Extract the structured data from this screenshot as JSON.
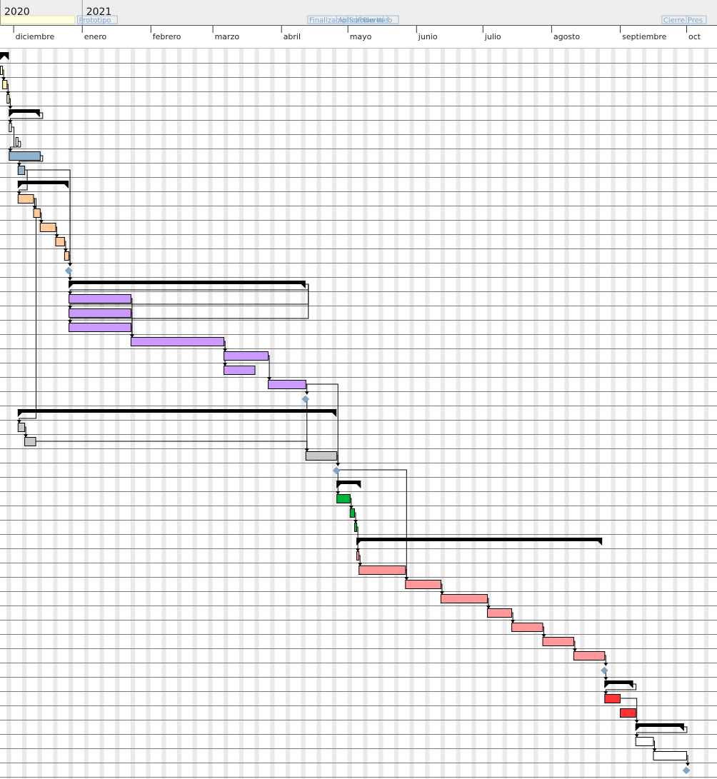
{
  "timeline": {
    "years": [
      {
        "label": "2020",
        "date": "2020-11-25"
      },
      {
        "label": "2021",
        "date": "2021-01-01"
      }
    ],
    "months": [
      {
        "label": "diciembre",
        "date": "2020-12-01"
      },
      {
        "label": "enero",
        "date": "2021-01-01"
      },
      {
        "label": "febrero",
        "date": "2021-02-01"
      },
      {
        "label": "marzo",
        "date": "2021-03-01"
      },
      {
        "label": "abril",
        "date": "2021-04-01"
      },
      {
        "label": "mayo",
        "date": "2021-05-01"
      },
      {
        "label": "junio",
        "date": "2021-06-01"
      },
      {
        "label": "julio",
        "date": "2021-07-01"
      },
      {
        "label": "agosto",
        "date": "2021-08-01"
      },
      {
        "label": "septiembre",
        "date": "2021-09-01"
      },
      {
        "label": "oct",
        "date": "2021-10-01"
      }
    ],
    "milestone_flags": [
      {
        "label": "Prototipo",
        "date": "2020-12-30"
      },
      {
        "label": "Finalizació",
        "date": "2021-04-13"
      },
      {
        "label": "Aplicación Web",
        "date": "2021-04-26"
      },
      {
        "label": "Software",
        "date": "2021-05-01"
      },
      {
        "label": "Cierre",
        "date": "2021-05-07"
      },
      {
        "label": "Cierre",
        "date": "2021-09-20"
      },
      {
        "label": "Pres",
        "date": "2021-10-01"
      }
    ],
    "highlight_flag": {
      "label": "",
      "date": "2020-11-25",
      "end": "2020-12-29"
    }
  },
  "colors": {
    "header_bg": "#eeeeee",
    "grid_line": "#7a7a7a",
    "weekend_band": "#eaeaea",
    "summary": "#000000",
    "milestone": "#7fa4c4",
    "link": "#000000",
    "flag_text": "#7ea7cf",
    "flag_border": "#9cc0df"
  },
  "tasks": [
    {
      "type": "summary",
      "start": "2020-11-25",
      "end": "2020-11-29"
    },
    {
      "type": "task",
      "start": "2020-11-25",
      "end": "2020-11-26",
      "color": "#ffffcc"
    },
    {
      "type": "task",
      "start": "2020-11-26",
      "end": "2020-11-28",
      "color": "#fff2b3"
    },
    {
      "type": "task",
      "start": "2020-11-28",
      "end": "2020-11-29",
      "color": "#ffffcc"
    },
    {
      "type": "summary",
      "start": "2020-11-29",
      "end": "2020-12-13"
    },
    {
      "type": "task",
      "start": "2020-11-29",
      "end": "2020-11-30",
      "color": "#ffffff"
    },
    {
      "type": "task",
      "start": "2020-12-02",
      "end": "2020-12-03",
      "color": "#ffffff"
    },
    {
      "type": "task",
      "start": "2020-11-29",
      "end": "2020-12-13",
      "color": "#8fb3cf"
    },
    {
      "type": "task",
      "start": "2020-12-03",
      "end": "2020-12-06",
      "color": "#8fb3cf"
    },
    {
      "type": "summary",
      "start": "2020-12-03",
      "end": "2020-12-26"
    },
    {
      "type": "task",
      "start": "2020-12-03",
      "end": "2020-12-10",
      "color": "#ffcc99"
    },
    {
      "type": "task",
      "start": "2020-12-10",
      "end": "2020-12-13",
      "color": "#ffcc99"
    },
    {
      "type": "task",
      "start": "2020-12-13",
      "end": "2020-12-20",
      "color": "#ffcc99"
    },
    {
      "type": "task",
      "start": "2020-12-20",
      "end": "2020-12-24",
      "color": "#ffcc99"
    },
    {
      "type": "task",
      "start": "2020-12-24",
      "end": "2020-12-26",
      "color": "#ffcc99"
    },
    {
      "type": "milestone",
      "start": "2020-12-26"
    },
    {
      "type": "summary",
      "start": "2020-12-26",
      "end": "2021-04-12"
    },
    {
      "type": "task",
      "start": "2020-12-26",
      "end": "2021-01-23",
      "color": "#cc99ff"
    },
    {
      "type": "task",
      "start": "2020-12-26",
      "end": "2021-01-23",
      "color": "#cc99ff"
    },
    {
      "type": "task",
      "start": "2020-12-26",
      "end": "2021-01-23",
      "color": "#cc99ff"
    },
    {
      "type": "task",
      "start": "2021-01-23",
      "end": "2021-03-06",
      "color": "#cc99ff"
    },
    {
      "type": "task",
      "start": "2021-03-06",
      "end": "2021-03-26",
      "color": "#cc99ff"
    },
    {
      "type": "task",
      "start": "2021-03-06",
      "end": "2021-03-20",
      "color": "#cc99ff"
    },
    {
      "type": "task",
      "start": "2021-03-26",
      "end": "2021-04-12",
      "color": "#cc99ff"
    },
    {
      "type": "milestone",
      "start": "2021-04-12"
    },
    {
      "type": "summary",
      "start": "2020-12-03",
      "end": "2021-04-26"
    },
    {
      "type": "task",
      "start": "2020-12-03",
      "end": "2020-12-06",
      "color": "#c8c8c8"
    },
    {
      "type": "task",
      "start": "2020-12-06",
      "end": "2020-12-11",
      "color": "#c8c8c8"
    },
    {
      "type": "task",
      "start": "2021-04-12",
      "end": "2021-04-26",
      "color": "#c8c8c8"
    },
    {
      "type": "milestone",
      "start": "2021-04-26"
    },
    {
      "type": "summary",
      "start": "2021-04-26",
      "end": "2021-05-07"
    },
    {
      "type": "task",
      "start": "2021-04-26",
      "end": "2021-05-02",
      "color": "#00b33c"
    },
    {
      "type": "task",
      "start": "2021-05-02",
      "end": "2021-05-04",
      "color": "#00b33c"
    },
    {
      "type": "task",
      "start": "2021-05-04",
      "end": "2021-05-05",
      "color": "#00b33c"
    },
    {
      "type": "summary",
      "start": "2021-05-05",
      "end": "2021-08-24"
    },
    {
      "type": "task",
      "start": "2021-05-05",
      "end": "2021-05-06",
      "color": "#ff9999"
    },
    {
      "type": "task",
      "start": "2021-05-06",
      "end": "2021-05-27",
      "color": "#ff9999"
    },
    {
      "type": "task",
      "start": "2021-05-27",
      "end": "2021-06-12",
      "color": "#ff9999"
    },
    {
      "type": "task",
      "start": "2021-06-12",
      "end": "2021-07-03",
      "color": "#ff9999"
    },
    {
      "type": "task",
      "start": "2021-07-03",
      "end": "2021-07-14",
      "color": "#ff9999"
    },
    {
      "type": "task",
      "start": "2021-07-14",
      "end": "2021-07-28",
      "color": "#ff9999"
    },
    {
      "type": "task",
      "start": "2021-07-28",
      "end": "2021-08-11",
      "color": "#ff9999"
    },
    {
      "type": "task",
      "start": "2021-08-11",
      "end": "2021-08-25",
      "color": "#ff9999"
    },
    {
      "type": "milestone",
      "start": "2021-08-25"
    },
    {
      "type": "summary",
      "start": "2021-08-25",
      "end": "2021-09-07"
    },
    {
      "type": "task",
      "start": "2021-08-25",
      "end": "2021-09-01",
      "color": "#ff3333"
    },
    {
      "type": "task",
      "start": "2021-09-01",
      "end": "2021-09-08",
      "color": "#ff3333"
    },
    {
      "type": "summary",
      "start": "2021-09-08",
      "end": "2021-09-30"
    },
    {
      "type": "task",
      "start": "2021-09-08",
      "end": "2021-09-16",
      "color": "#ffffff"
    },
    {
      "type": "task",
      "start": "2021-09-16",
      "end": "2021-10-01",
      "color": "#ffffff"
    },
    {
      "type": "milestone",
      "start": "2021-10-01"
    }
  ],
  "links": [
    [
      1,
      2
    ],
    [
      2,
      3
    ],
    [
      3,
      4
    ],
    [
      4,
      5
    ],
    [
      5,
      7
    ],
    [
      6,
      7
    ],
    [
      7,
      8
    ],
    [
      8,
      10
    ],
    [
      10,
      11
    ],
    [
      11,
      12
    ],
    [
      12,
      13
    ],
    [
      13,
      14
    ],
    [
      14,
      15
    ],
    [
      15,
      16
    ],
    [
      8,
      15
    ],
    [
      16,
      17
    ],
    [
      16,
      18
    ],
    [
      16,
      19
    ],
    [
      17,
      20
    ],
    [
      18,
      20
    ],
    [
      19,
      20
    ],
    [
      20,
      21
    ],
    [
      20,
      22
    ],
    [
      21,
      23
    ],
    [
      23,
      24
    ],
    [
      10,
      26
    ],
    [
      26,
      27
    ],
    [
      27,
      28
    ],
    [
      24,
      28
    ],
    [
      23,
      29
    ],
    [
      28,
      29
    ],
    [
      29,
      31
    ],
    [
      31,
      32
    ],
    [
      32,
      33
    ],
    [
      33,
      35
    ],
    [
      35,
      36
    ],
    [
      29,
      37
    ],
    [
      36,
      37
    ],
    [
      37,
      38
    ],
    [
      38,
      39
    ],
    [
      39,
      40
    ],
    [
      40,
      41
    ],
    [
      41,
      42
    ],
    [
      42,
      43
    ],
    [
      43,
      44
    ],
    [
      44,
      45
    ],
    [
      45,
      47
    ],
    [
      47,
      48
    ],
    [
      48,
      49
    ],
    [
      49,
      50
    ]
  ]
}
